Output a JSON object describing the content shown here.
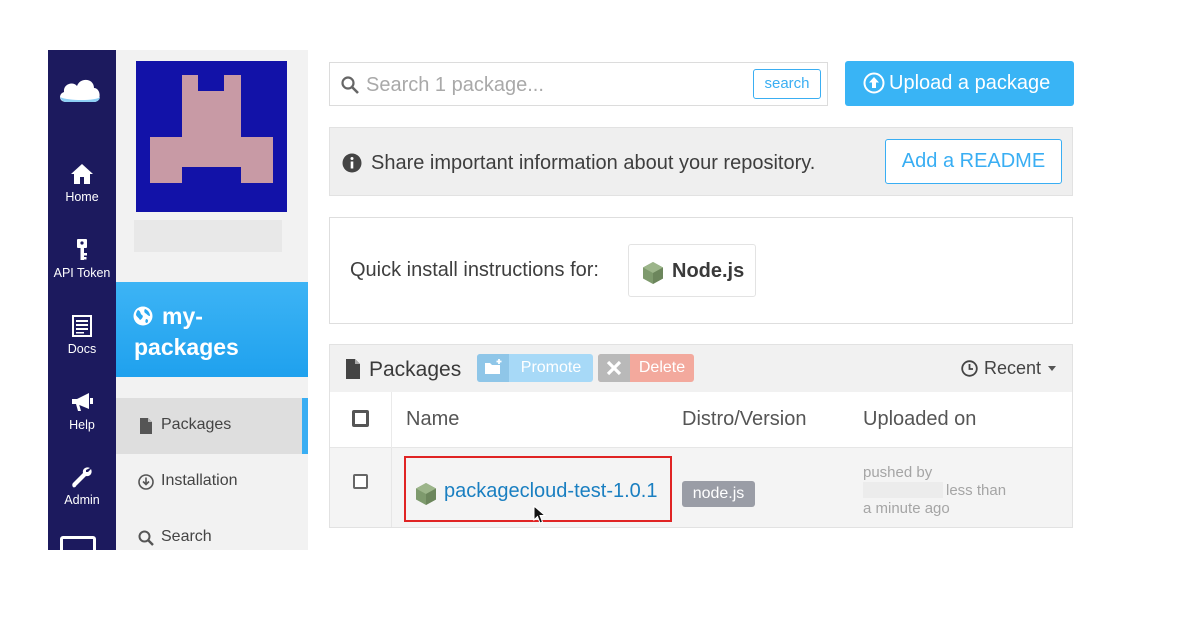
{
  "nav": {
    "items": [
      {
        "label": "Home",
        "icon": "home-icon"
      },
      {
        "label": "API Token",
        "icon": "key-icon"
      },
      {
        "label": "Docs",
        "icon": "docs-icon"
      },
      {
        "label": "Help",
        "icon": "megaphone-icon"
      },
      {
        "label": "Admin",
        "icon": "wrench-icon"
      }
    ]
  },
  "sidebar": {
    "repo_name": "my-packages",
    "links": [
      {
        "label": "Packages",
        "icon": "file-icon",
        "active": true
      },
      {
        "label": "Installation",
        "icon": "download-icon",
        "active": false
      },
      {
        "label": "Search",
        "icon": "search-icon",
        "active": false
      }
    ]
  },
  "search": {
    "placeholder": "Search 1 package...",
    "button_label": "search"
  },
  "upload": {
    "label": "Upload a package"
  },
  "readme": {
    "message": "Share important information about your repository.",
    "button_label": "Add a README"
  },
  "quick_install": {
    "label": "Quick install instructions for:",
    "language": "Node.js"
  },
  "packages": {
    "title": "Packages",
    "promote_label": "Promote",
    "delete_label": "Delete",
    "sort_label": "Recent",
    "columns": [
      "Name",
      "Distro/Version",
      "Uploaded on"
    ],
    "rows": [
      {
        "name": "packagecloud-test-1.0.1",
        "distro": "node.js",
        "uploaded_line1": "pushed by",
        "uploaded_line2": "less than",
        "uploaded_line3": "a minute ago"
      }
    ]
  },
  "colors": {
    "nav_bg": "#1c1a5e",
    "accent": "#39b4f5",
    "highlight": "#e02424"
  }
}
